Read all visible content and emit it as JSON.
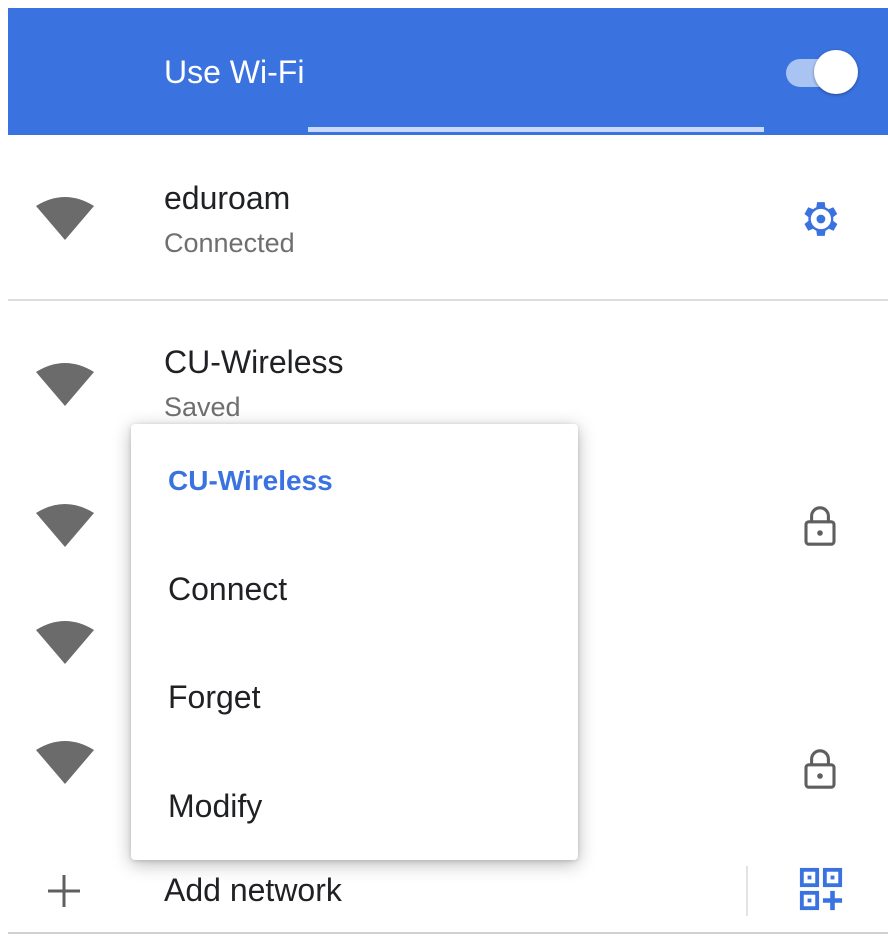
{
  "header": {
    "title": "Use Wi-Fi",
    "toggle_on": true,
    "accent_color": "#3a72e0"
  },
  "networks": [
    {
      "name": "eduroam",
      "status": "Connected",
      "trailing_icon": "gear-icon"
    },
    {
      "name": "CU-Wireless",
      "status": "Saved",
      "trailing_icon": ""
    },
    {
      "name": "",
      "status": "",
      "trailing_icon": "lock-icon"
    },
    {
      "name": "",
      "status": "",
      "trailing_icon": ""
    },
    {
      "name": "",
      "status": "",
      "trailing_icon": "lock-icon"
    }
  ],
  "context_menu": {
    "title": "CU-Wireless",
    "items": [
      "Connect",
      "Forget",
      "Modify"
    ]
  },
  "footer": {
    "add_label": "Add network",
    "add_icon": "plus-icon",
    "qr_icon": "qr-code-scan-icon"
  }
}
